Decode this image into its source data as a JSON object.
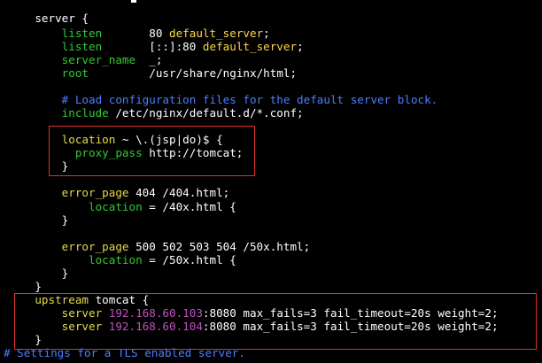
{
  "colors": {
    "background": "#000000",
    "text": "#ffffff",
    "directive_yellow": "#e6d94a",
    "directive_green": "#34c934",
    "comment_blue": "#4f7dff",
    "ip_magenta": "#c050c0",
    "highlight_box": "#e03030"
  },
  "editor": {
    "lines": [
      {
        "indent": "    ",
        "tokens": [
          {
            "t": "server {",
            "c": "w"
          }
        ]
      },
      {
        "indent": "        ",
        "tokens": [
          {
            "t": "listen",
            "c": "g"
          },
          {
            "t": "       80 ",
            "c": "w"
          },
          {
            "t": "default_server",
            "c": "k"
          },
          {
            "t": ";",
            "c": "w"
          }
        ]
      },
      {
        "indent": "        ",
        "tokens": [
          {
            "t": "listen",
            "c": "g"
          },
          {
            "t": "       [::]:80 ",
            "c": "w"
          },
          {
            "t": "default_server",
            "c": "k"
          },
          {
            "t": ";",
            "c": "w"
          }
        ]
      },
      {
        "indent": "        ",
        "tokens": [
          {
            "t": "server_name",
            "c": "g"
          },
          {
            "t": "  _;",
            "c": "w"
          }
        ]
      },
      {
        "indent": "        ",
        "tokens": [
          {
            "t": "root",
            "c": "g"
          },
          {
            "t": "         /usr/share/nginx/html;",
            "c": "w"
          }
        ]
      },
      {
        "indent": "",
        "tokens": []
      },
      {
        "indent": "        ",
        "tokens": [
          {
            "t": "# Load configuration files for the default server block.",
            "c": "b"
          }
        ]
      },
      {
        "indent": "        ",
        "tokens": [
          {
            "t": "include",
            "c": "g"
          },
          {
            "t": " /etc/nginx/default.d/*.conf;",
            "c": "w"
          }
        ]
      },
      {
        "indent": "",
        "tokens": []
      },
      {
        "indent": "        ",
        "tokens": [
          {
            "t": "location",
            "c": "y"
          },
          {
            "t": " ~ \\.(jsp|do)$ {",
            "c": "w"
          }
        ]
      },
      {
        "indent": "          ",
        "tokens": [
          {
            "t": "proxy_pass",
            "c": "g"
          },
          {
            "t": " http://tomcat;",
            "c": "w"
          }
        ]
      },
      {
        "indent": "        ",
        "tokens": [
          {
            "t": "}",
            "c": "w"
          }
        ]
      },
      {
        "indent": "",
        "tokens": []
      },
      {
        "indent": "        ",
        "tokens": [
          {
            "t": "error_page",
            "c": "y"
          },
          {
            "t": " 404 /404.html;",
            "c": "w"
          }
        ]
      },
      {
        "indent": "            ",
        "tokens": [
          {
            "t": "location",
            "c": "g"
          },
          {
            "t": " = /40x.html {",
            "c": "w"
          }
        ]
      },
      {
        "indent": "        ",
        "tokens": [
          {
            "t": "}",
            "c": "w"
          }
        ]
      },
      {
        "indent": "",
        "tokens": []
      },
      {
        "indent": "        ",
        "tokens": [
          {
            "t": "error_page",
            "c": "y"
          },
          {
            "t": " 500 502 503 504 /50x.html;",
            "c": "w"
          }
        ]
      },
      {
        "indent": "            ",
        "tokens": [
          {
            "t": "location",
            "c": "g"
          },
          {
            "t": " = /50x.html {",
            "c": "w"
          }
        ]
      },
      {
        "indent": "        ",
        "tokens": [
          {
            "t": "}",
            "c": "w"
          }
        ]
      },
      {
        "indent": "    ",
        "tokens": [
          {
            "t": "}",
            "c": "w"
          }
        ]
      },
      {
        "indent": "    ",
        "tokens": [
          {
            "t": "upstream",
            "c": "y"
          },
          {
            "t": " tomcat {",
            "c": "w"
          }
        ]
      },
      {
        "indent": "        ",
        "tokens": [
          {
            "t": "server",
            "c": "y"
          },
          {
            "t": " ",
            "c": "w"
          },
          {
            "t": "192.168.60.103",
            "c": "m"
          },
          {
            "t": ":8080 max_fails=3 fail_timeout=20s weight=2;",
            "c": "w"
          }
        ]
      },
      {
        "indent": "        ",
        "tokens": [
          {
            "t": "server",
            "c": "y"
          },
          {
            "t": " ",
            "c": "w"
          },
          {
            "t": "192.168.60.104",
            "c": "m"
          },
          {
            "t": ":8080 max_fails=3 fail_timeout=20s weight=2;",
            "c": "w"
          }
        ]
      },
      {
        "indent": "    ",
        "tokens": [
          {
            "t": "}",
            "c": "w"
          }
        ]
      },
      {
        "indent": "",
        "tokens": [
          {
            "t": "# Settings for a TLS enabled server.",
            "c": "b"
          }
        ]
      }
    ]
  }
}
